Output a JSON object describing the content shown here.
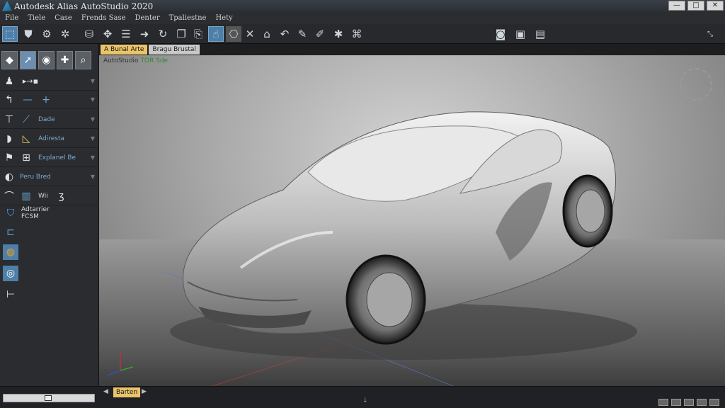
{
  "window": {
    "title": "Autodesk Alias AutoStudio 2020",
    "controls": [
      "—",
      "□",
      "✕"
    ]
  },
  "menu": [
    "File",
    "Tiele",
    "Case",
    "Frends Sase",
    "Denter",
    "Tpaliestne",
    "Hety"
  ],
  "toolbar": {
    "icons": [
      "pick-icon",
      "shield-icon",
      "gear-icon",
      "settings-icon",
      "vessel-icon",
      "transform-icon",
      "align-icon",
      "arrow-right-icon",
      "rotate-icon",
      "copy-icon",
      "paste-icon",
      "select-icon",
      "camera-icon",
      "cross-icon",
      "house-icon",
      "undo-icon",
      "pen-icon",
      "brush-icon",
      "star-icon",
      "node-icon"
    ],
    "right_icons": [
      "view-a-icon",
      "view-b-icon",
      "view-c-icon"
    ]
  },
  "tabs": [
    {
      "label": "A Bunal Arte"
    },
    {
      "label": "Bragu Brustal"
    }
  ],
  "palette": {
    "rows": [
      {
        "label": ""
      },
      {
        "label": ""
      },
      {
        "label": "Dade"
      },
      {
        "label": "Adiresta"
      },
      {
        "label": "Explanel Be"
      },
      {
        "label": "Peru Bred"
      },
      {
        "label": ""
      }
    ],
    "small_labels": [
      "Adtarrier",
      "FCSM"
    ],
    "row6_label": "Wii"
  },
  "viewport": {
    "label_prefix": "AutoStudio ",
    "label_highlight": "TOR Sde"
  },
  "status": {
    "button": "Barten"
  },
  "colors": {
    "accent": "#e9c46a",
    "selected": "#4e7fa8",
    "label_blue": "#7faad0"
  }
}
